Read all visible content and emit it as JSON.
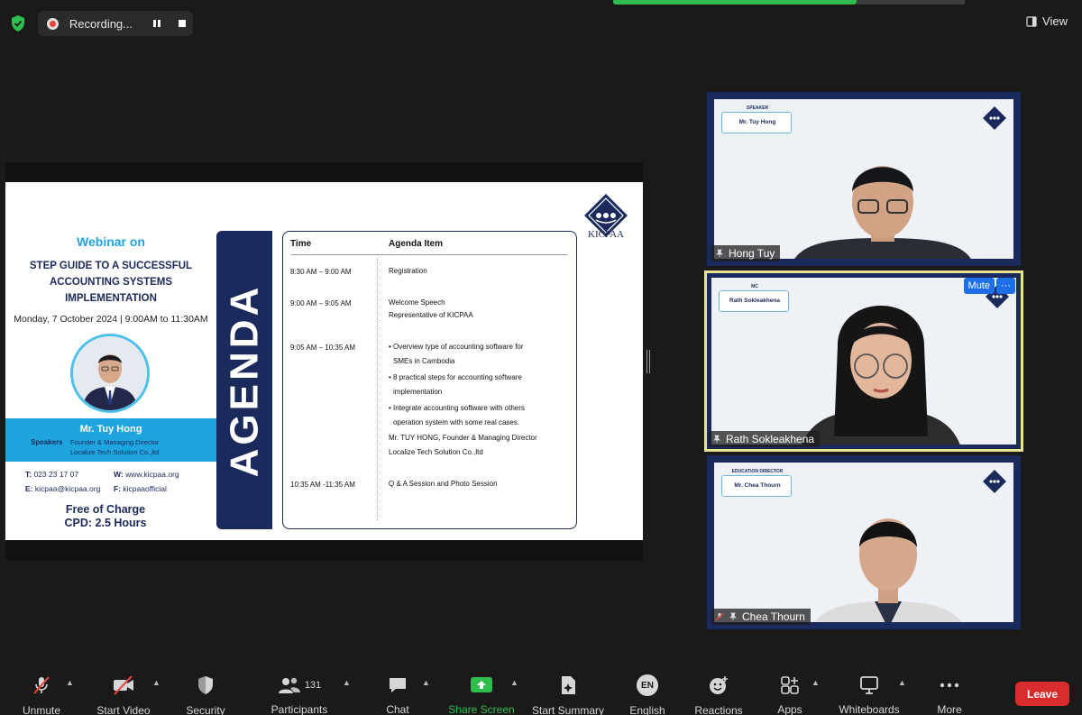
{
  "top": {
    "recording_label": "Recording...",
    "view_label": "View"
  },
  "slide": {
    "webinar_title": "Webinar on",
    "heading": "STEP GUIDE TO A SUCCESSFUL ACCOUNTING SYSTEMS IMPLEMENTATION",
    "date": "Monday, 7 October 2024 | 9:00AM to 11:30AM",
    "speaker_name": "Mr. Tuy Hong",
    "speaker_role": "Speakers",
    "speaker_title": "Founder & Managing Director",
    "speaker_company": "Localize Tech Solution Co.,ltd",
    "contact_t": "023 23 17 07",
    "contact_w": "www.kicpaa.org",
    "contact_e": "kicpaa@kicpaa.org",
    "contact_f": "kicpaaofficial",
    "contact_t_label": "T:",
    "contact_w_label": "W:",
    "contact_e_label": "E:",
    "contact_f_label": "F:",
    "free_line1": "Free of Charge",
    "free_line2": "CPD: 2.5 Hours",
    "agenda_word": "AGENDA",
    "logo_text": "KICPAA",
    "table": {
      "col_time": "Time",
      "col_item": "Agenda Item",
      "rows": [
        {
          "time": "8:30 AM – 9:00 AM",
          "lines": [
            "Registration"
          ]
        },
        {
          "time": "9:00 AM – 9:05 AM",
          "lines": [
            "Welcome Speech",
            "Representative of KICPAA"
          ]
        },
        {
          "time": "9:05 AM – 10:35 AM",
          "lines": [
            "• Overview type of accounting software for",
            "SMEs in Cambodia",
            "• 8 practical steps for accounting software",
            "implementation",
            "• Integrate accounting software with others",
            "operation system with some real cases.",
            "Mr. TUY HONG, Founder & Managing Director",
            "Localize Tech Solution Co.,ltd"
          ]
        },
        {
          "time": "10:35 AM -11:35 AM",
          "lines": [
            "Q & A Session and Photo Session"
          ]
        }
      ]
    }
  },
  "participants": [
    {
      "name": "Hong Tuy",
      "tag_role": "SPEAKER",
      "tag_name": "Mr. Tuy Hong"
    },
    {
      "name": "Rath Sokleakhena",
      "tag_role": "MC",
      "tag_name": "Rath Sokleakhena",
      "mute_label": "Mute",
      "more_label": "···"
    },
    {
      "name": "Chea Thourn",
      "tag_role": "EDUCATION DIRECTOR",
      "tag_name": "Mr. Chea Thourn"
    }
  ],
  "toolbar": {
    "unmute": "Unmute",
    "start_video": "Start Video",
    "security": "Security",
    "participants": "Participants",
    "participants_count": "131",
    "chat": "Chat",
    "share_screen": "Share Screen",
    "start_summary": "Start Summary",
    "english": "English",
    "english_badge": "EN",
    "reactions": "Reactions",
    "apps": "Apps",
    "whiteboards": "Whiteboards",
    "more": "More",
    "leave": "Leave"
  },
  "colors": {
    "share_green": "#2fbe4e",
    "leave_red": "#d92d2d",
    "active_speaker": "#e9e58e",
    "navy": "#1b2a5c",
    "cyan": "#1ea4de"
  }
}
